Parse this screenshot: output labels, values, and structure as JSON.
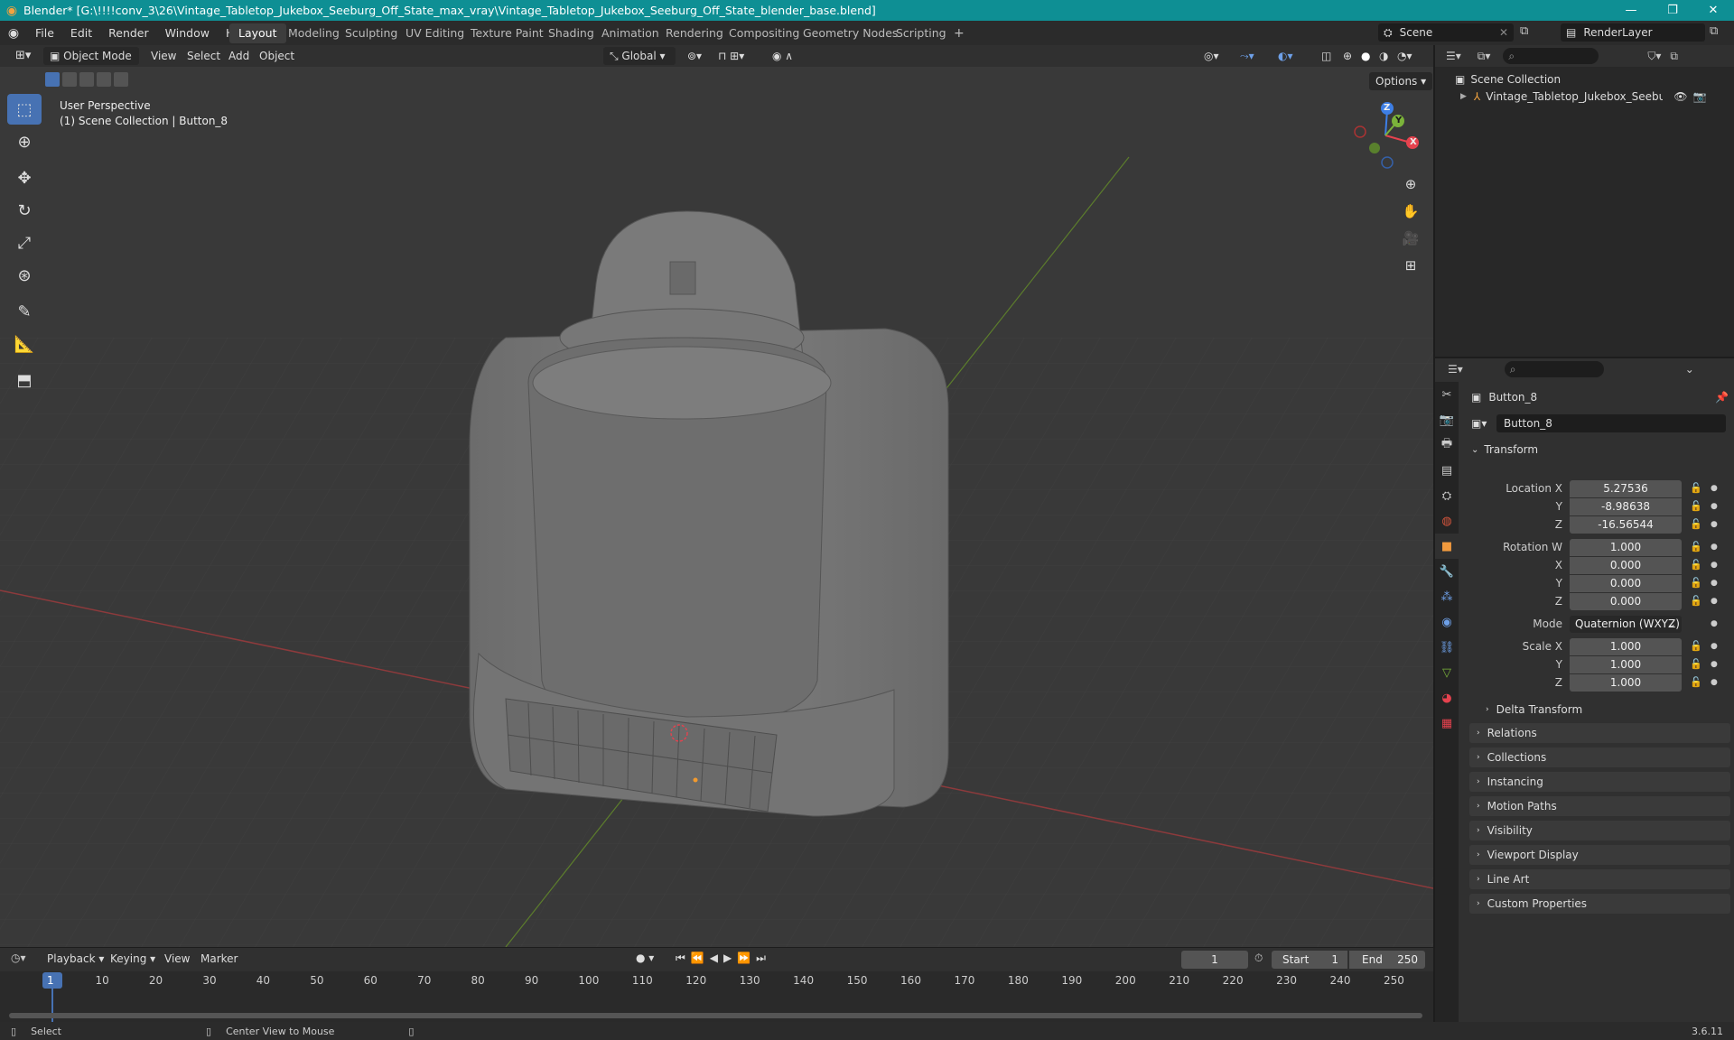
{
  "window": {
    "title": "Blender* [G:\\!!!!conv_3\\26\\Vintage_Tabletop_Jukebox_Seeburg_Off_State_max_vray\\Vintage_Tabletop_Jukebox_Seeburg_Off_State_blender_base.blend]",
    "minimize": "—",
    "maximize": "❐",
    "close": "✕"
  },
  "menu": [
    "File",
    "Edit",
    "Render",
    "Window",
    "Help"
  ],
  "workspaces": [
    "Layout",
    "Modeling",
    "Sculpting",
    "UV Editing",
    "Texture Paint",
    "Shading",
    "Animation",
    "Rendering",
    "Compositing",
    "Geometry Nodes",
    "Scripting"
  ],
  "workspace_add": "+",
  "scene": {
    "scene_name": "Scene",
    "view_layer": "RenderLayer"
  },
  "viewport_header": {
    "mode": "Object Mode",
    "menus": [
      "View",
      "Select",
      "Add",
      "Object"
    ],
    "orientation": "Global",
    "options": "Options"
  },
  "viewport": {
    "perspective": "User Perspective",
    "collection_path": "(1) Scene Collection | Button_8",
    "gizmo": {
      "z": "Z",
      "y": "Y",
      "x": "X"
    }
  },
  "outliner": {
    "root": "Scene Collection",
    "items": [
      {
        "label": "Vintage_Tabletop_Jukebox_Seeburg_Off"
      }
    ]
  },
  "properties": {
    "object_name": "Button_8",
    "data_name": "Button_8",
    "transform_title": "Transform",
    "location": {
      "label": "Location X",
      "x": "5.27536",
      "y_label": "Y",
      "y": "-8.98638",
      "z_label": "Z",
      "z": "-16.56544"
    },
    "rotation": {
      "label": "Rotation W",
      "w": "1.000",
      "x_label": "X",
      "x": "0.000",
      "y_label": "Y",
      "y": "0.000",
      "z_label": "Z",
      "z": "0.000"
    },
    "mode": {
      "label": "Mode",
      "value": "Quaternion (WXYZ)"
    },
    "scale": {
      "label": "Scale X",
      "x": "1.000",
      "y_label": "Y",
      "y": "1.000",
      "z_label": "Z",
      "z": "1.000"
    },
    "delta": "Delta Transform",
    "panels": [
      "Relations",
      "Collections",
      "Instancing",
      "Motion Paths",
      "Visibility",
      "Viewport Display",
      "Line Art",
      "Custom Properties"
    ]
  },
  "timeline": {
    "menus": [
      "Playback",
      "Keying",
      "View",
      "Marker"
    ],
    "current_frame": "1",
    "start_label": "Start",
    "start": "1",
    "end_label": "End",
    "end": "250",
    "ticks": [
      "1",
      "10",
      "20",
      "30",
      "40",
      "50",
      "60",
      "70",
      "80",
      "90",
      "100",
      "110",
      "120",
      "130",
      "140",
      "150",
      "160",
      "170",
      "180",
      "190",
      "200",
      "210",
      "220",
      "230",
      "240",
      "250"
    ]
  },
  "status": {
    "select": "Select",
    "center": "Center View to Mouse",
    "version": "3.6.11"
  },
  "colors": {
    "accent": "#4772b3",
    "title_bar": "#0e8f94",
    "x_axis": "#e5424e",
    "y_axis": "#7bb33a",
    "z_axis": "#3d7ee5"
  }
}
